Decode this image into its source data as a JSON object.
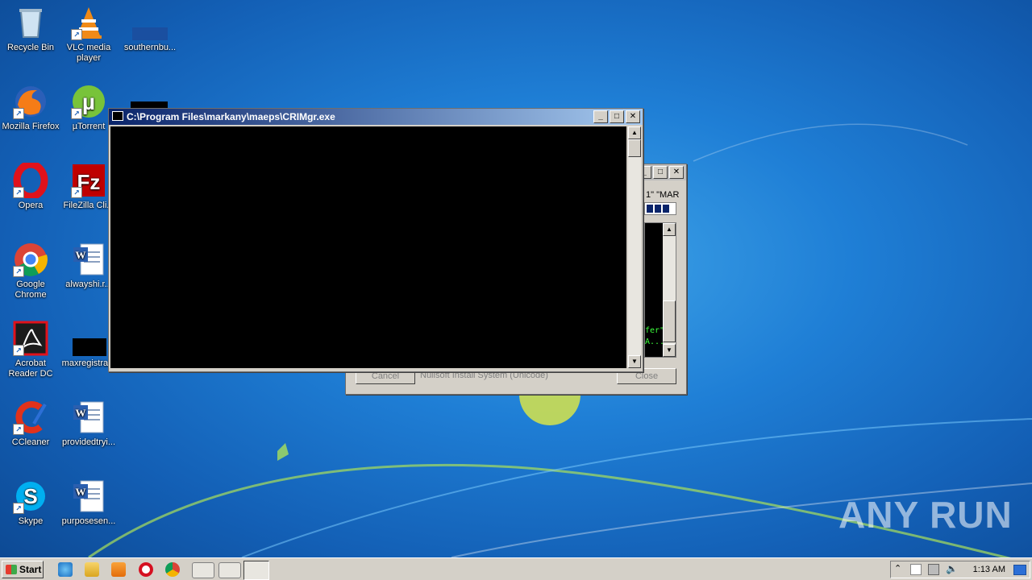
{
  "desktop": {
    "icons": [
      {
        "label": "Recycle Bin"
      },
      {
        "label": "VLC media player"
      },
      {
        "label": "southernbu..."
      },
      {
        "label": "Mozilla Firefox"
      },
      {
        "label": "µTorrent"
      },
      {
        "label": "Opera"
      },
      {
        "label": "FileZilla Cli..."
      },
      {
        "label": "Google Chrome"
      },
      {
        "label": "alwayshi.r..."
      },
      {
        "label": "Acrobat Reader DC"
      },
      {
        "label": "maxregistra..."
      },
      {
        "label": "CCleaner"
      },
      {
        "label": "providedtryi..."
      },
      {
        "label": "Skype"
      },
      {
        "label": "purposesen..."
      }
    ]
  },
  "console_window": {
    "title": "C:\\Program Files\\markany\\maeps\\CRIMgr.exe"
  },
  "installer_window": {
    "fragment_top": "1\" \"MAR",
    "log_fragment_1": "fer\"",
    "log_fragment_2": "A...",
    "cancel_label": "Cancel",
    "branding": "Nullsoft Install System (Unicode)",
    "close_label": "Close"
  },
  "taskbar": {
    "start_label": "Start",
    "clock": "1:13 AM"
  },
  "watermark": "ANY RUN",
  "colors": {
    "title_active_start": "#0a246a",
    "title_active_end": "#a6caf0",
    "console_bg": "#000000"
  }
}
